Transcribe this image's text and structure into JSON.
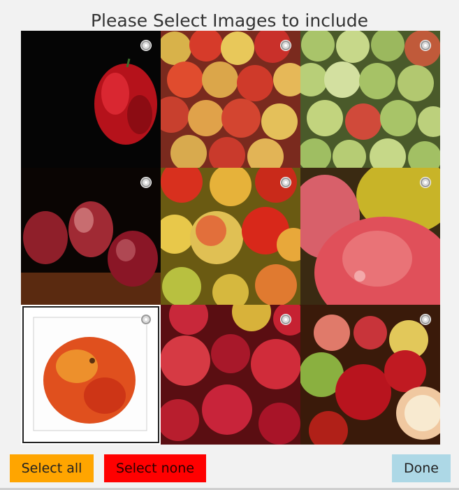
{
  "dialog": {
    "title": "Please Select Images to include"
  },
  "images": [
    {
      "icon": "apple-photo-single-red-black-bg",
      "selected": false
    },
    {
      "icon": "apple-photo-pile-mixed",
      "selected": false
    },
    {
      "icon": "apple-photo-pile-green",
      "selected": false
    },
    {
      "icon": "apple-photo-three-red",
      "selected": false
    },
    {
      "icon": "apple-photo-pile-red-yellow",
      "selected": false
    },
    {
      "icon": "apple-photo-closeup-wet",
      "selected": false
    },
    {
      "icon": "apple-photo-single-white-bg",
      "selected": false
    },
    {
      "icon": "apple-photo-pile-red",
      "selected": false
    },
    {
      "icon": "apple-photo-sliced",
      "selected": false
    }
  ],
  "buttons": {
    "select_all": "Select all",
    "select_none": "Select none",
    "done": "Done"
  },
  "colors": {
    "select_all_bg": "#ffa500",
    "select_none_bg": "#ff0000",
    "done_bg": "#add8e6",
    "background": "#f2f2f2"
  }
}
